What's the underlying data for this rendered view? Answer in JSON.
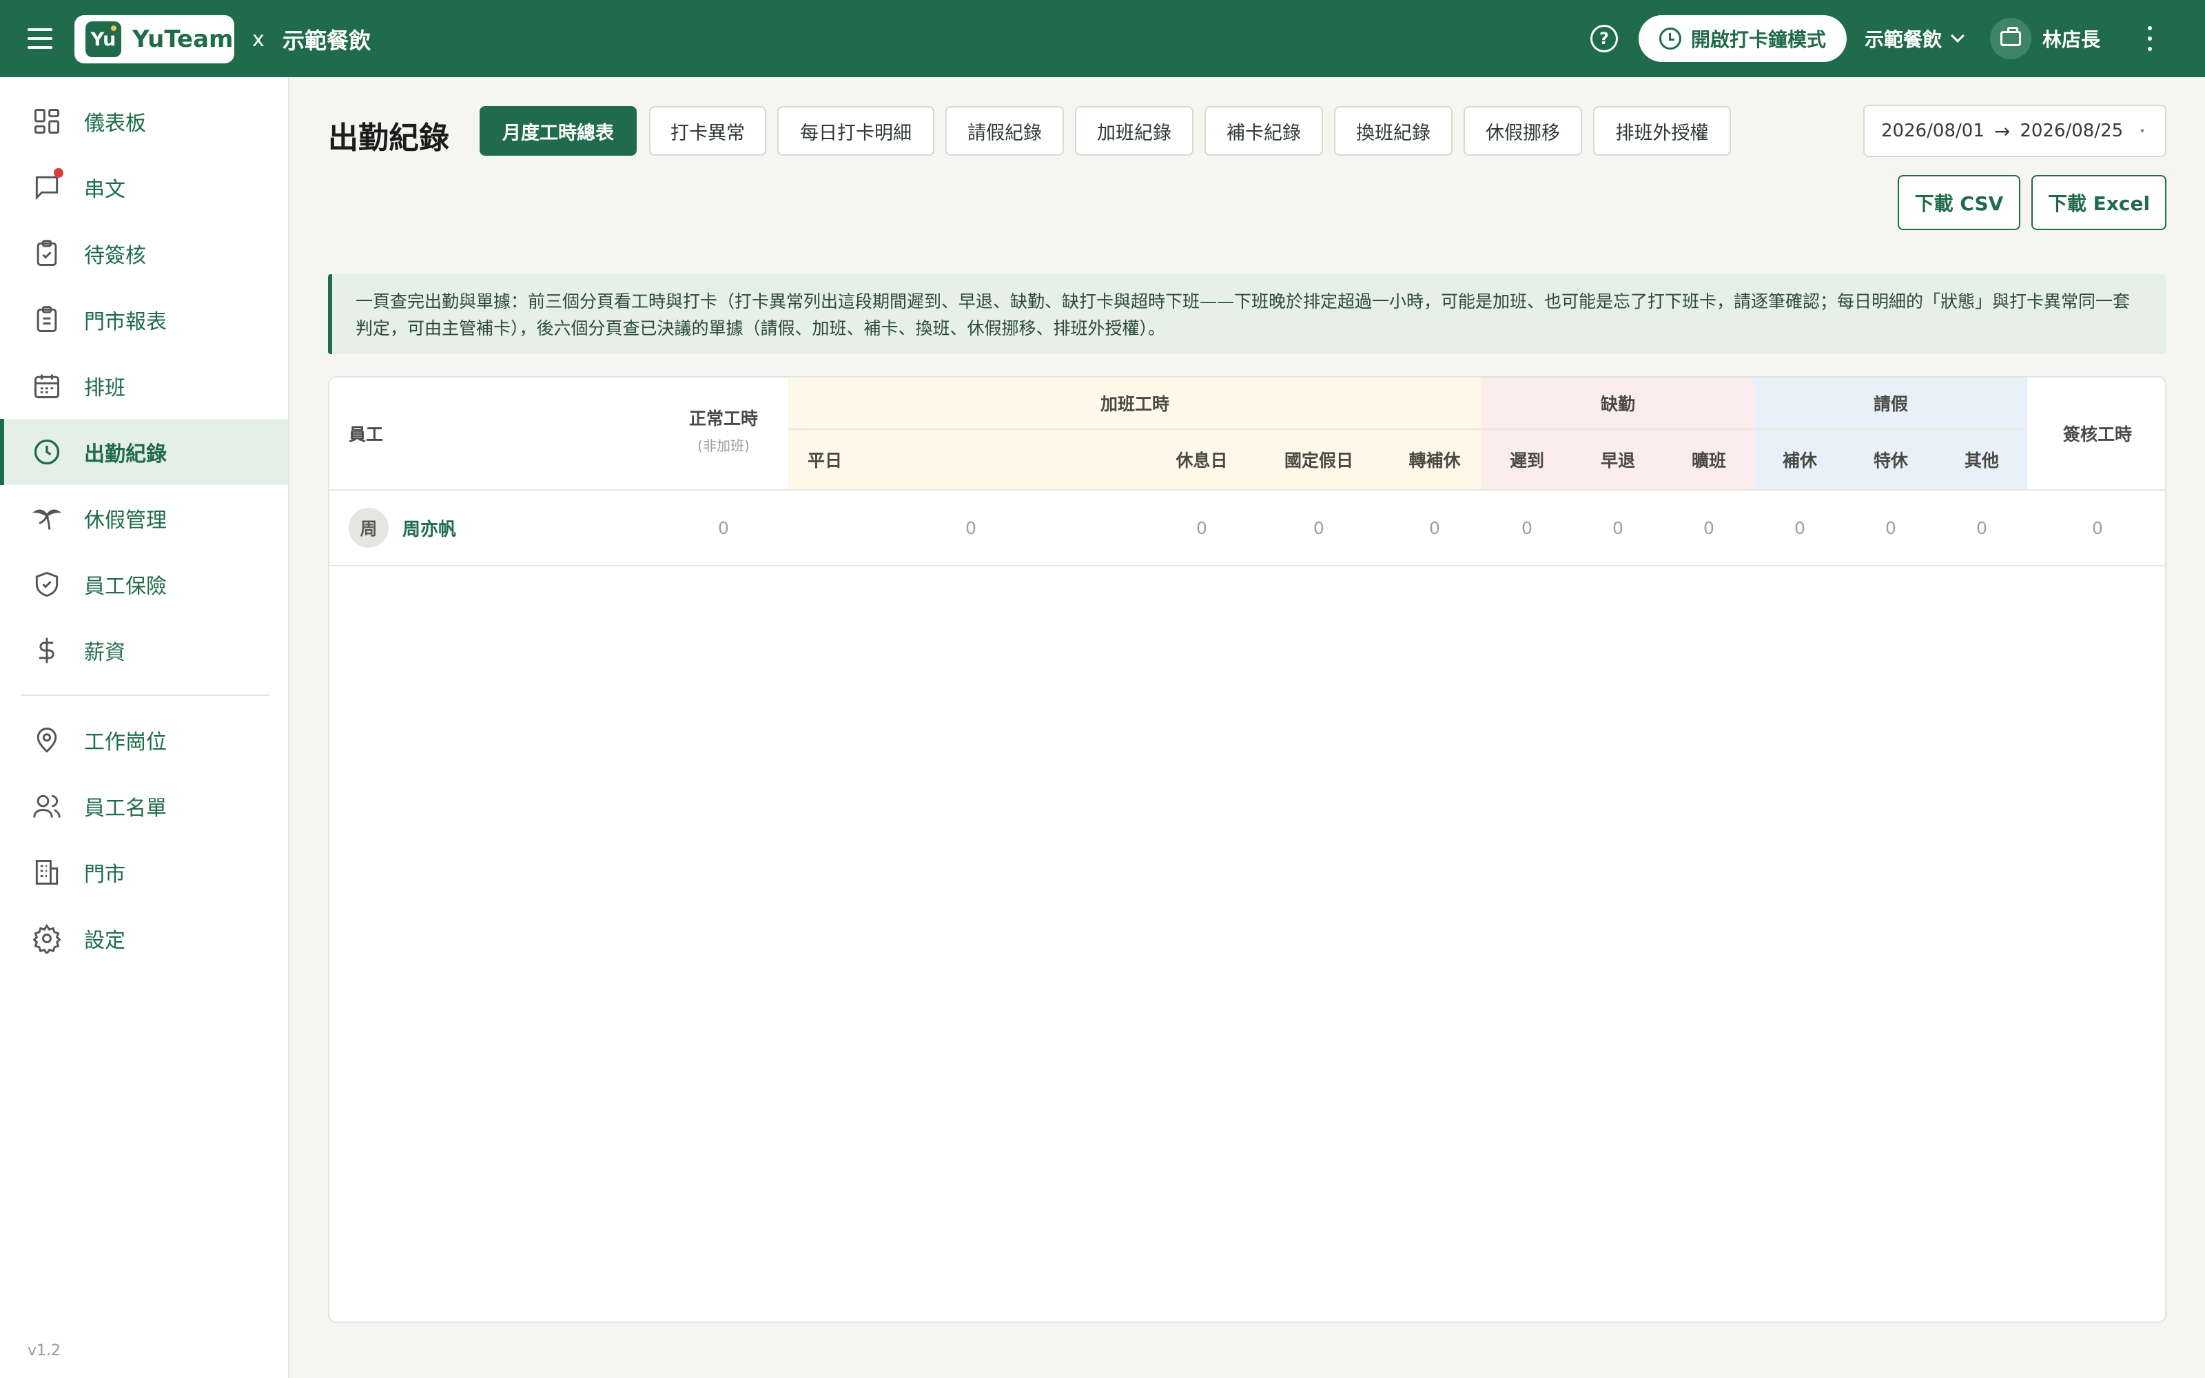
{
  "topbar": {
    "brand_name": "YuTeam",
    "brand_logo_text": "Yu",
    "x": "x",
    "partner": "示範餐飲",
    "clock_mode_label": "開啟打卡鐘模式",
    "store_label": "示範餐飲",
    "user_name": "林店長"
  },
  "sidebar": {
    "items": [
      {
        "label": "儀表板",
        "icon": "dashboard-icon"
      },
      {
        "label": "串文",
        "icon": "chat-icon"
      },
      {
        "label": "待簽核",
        "icon": "clipboard-check-icon"
      },
      {
        "label": "門市報表",
        "icon": "report-icon"
      },
      {
        "label": "排班",
        "icon": "calendar-icon"
      },
      {
        "label": "出勤紀錄",
        "icon": "clock-icon",
        "active": true
      },
      {
        "label": "休假管理",
        "icon": "palm-tree-icon"
      },
      {
        "label": "員工保險",
        "icon": "shield-icon"
      },
      {
        "label": "薪資",
        "icon": "dollar-icon"
      },
      {
        "label": "工作崗位",
        "icon": "location-icon"
      },
      {
        "label": "員工名單",
        "icon": "users-icon"
      },
      {
        "label": "門市",
        "icon": "building-icon"
      },
      {
        "label": "設定",
        "icon": "gear-icon"
      }
    ],
    "version": "v1.2"
  },
  "main": {
    "title": "出勤紀錄",
    "tabs": [
      "月度工時總表",
      "打卡異常",
      "每日打卡明細",
      "請假紀錄",
      "加班紀錄",
      "補卡紀錄",
      "換班紀錄",
      "休假挪移",
      "排班外授權"
    ],
    "active_tab": 0,
    "date_from": "2026/08/01",
    "date_arrow": "→",
    "date_to": "2026/08/25",
    "download_csv": "下載 CSV",
    "download_excel": "下載 Excel",
    "info": "一頁查完出勤與單據：前三個分頁看工時與打卡（打卡異常列出這段期間遲到、早退、缺勤、缺打卡與超時下班——下班晚於排定超過一小時，可能是加班、也可能是忘了打下班卡，請逐筆確認；每日明細的「狀態」與打卡異常同一套判定，可由主管補卡），後六個分頁查已決議的單據（請假、加班、補卡、換班、休假挪移、排班外授權）。"
  },
  "table": {
    "headers": {
      "employee": "員工",
      "normal": "正常工時",
      "normal_sub": "(非加班)",
      "overtime_group": "加班工時",
      "ot_weekday": "平日",
      "ot_restday": "休息日",
      "ot_holiday": "國定假日",
      "ot_comp": "轉補休",
      "absence_group": "缺勤",
      "late": "遲到",
      "early": "早退",
      "noshow": "曠班",
      "leave_group": "請假",
      "comp_leave": "補休",
      "special_leave": "特休",
      "other_leave": "其他",
      "approved_hours": "簽核工時"
    },
    "rows": [
      {
        "avatar": "周",
        "name": "周亦帆",
        "normal": "0",
        "ot_weekday": "0",
        "ot_restday": "0",
        "ot_holiday": "0",
        "ot_comp": "0",
        "late": "0",
        "early": "0",
        "noshow": "0",
        "comp_leave": "0",
        "special_leave": "0",
        "other_leave": "0",
        "approved_hours": "0"
      }
    ]
  },
  "colors": {
    "primary": "#1f6b4b",
    "overtime_bg": "#fdf8ea",
    "absence_bg": "#fbeced",
    "leave_bg": "#e8f0fa"
  }
}
